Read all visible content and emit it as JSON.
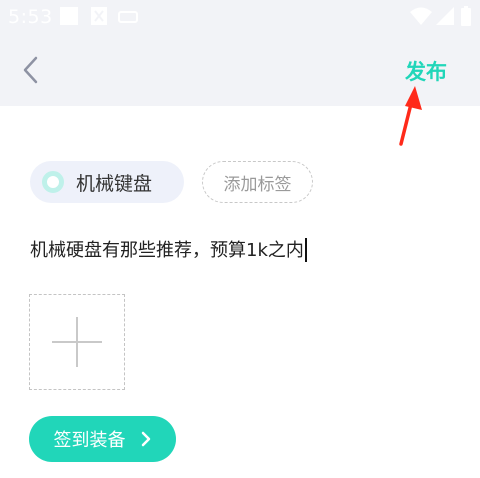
{
  "status_bar": {
    "time": "5:53",
    "icons": [
      "notification-square-icon",
      "notification-x-icon",
      "cast-icon",
      "wifi-icon",
      "signal-icon",
      "battery-icon"
    ]
  },
  "toolbar": {
    "back_icon": "chevron-left-icon",
    "publish_label": "发布",
    "publish_color": "#21d6b9"
  },
  "annotation": {
    "icon": "red-arrow-icon",
    "color": "#ff2a1a"
  },
  "tags": {
    "selected_label": "机械键盘",
    "add_label": "添加标签"
  },
  "editor": {
    "text": "机械硬盘有那些推荐，预算1k之内"
  },
  "image_upload": {
    "icon": "plus-icon"
  },
  "equipment_button": {
    "label": "签到装备",
    "icon": "chevron-right-icon",
    "color": "#21d6b9"
  }
}
